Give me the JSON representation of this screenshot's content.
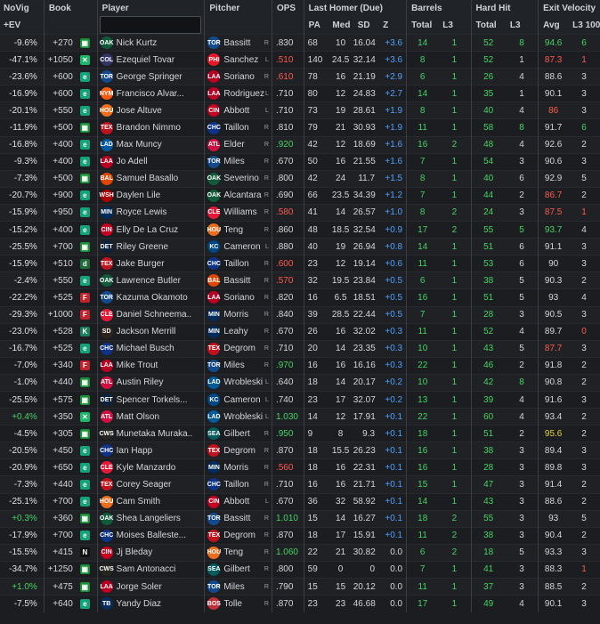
{
  "headers": {
    "novig": "NoVig",
    "novig2": "+EV",
    "book": "Book",
    "player": "Player",
    "pitcher": "Pitcher",
    "ops": "OPS",
    "last_homer": "Last Homer (Due)",
    "barrels": "Barrels",
    "hard_hit": "Hard Hit",
    "exit_velocity": "Exit Velocity",
    "pa": "PA",
    "med": "Med",
    "sd": "SD",
    "z": "Z",
    "bar_total": "Total",
    "bar_l3": "L3",
    "hh_total": "Total",
    "hh_l3": "L3",
    "ev_avg": "Avg",
    "ev_l3": "L3 100"
  },
  "search": {
    "placeholder": ""
  },
  "colors": {
    "pos": "#45d363",
    "neg": "#ff5a4f",
    "z": "#4ea1ff",
    "mid": "#e3d23f"
  },
  "rows": [
    {
      "nv": "-9.6%",
      "odds": "+270",
      "book": "B",
      "player": "Nick Kurtz",
      "tm": "OAK",
      "pitcher": "Bassitt",
      "ptm": "TOR",
      "hand": "R",
      "ops": ".830",
      "opsc": "wh",
      "pa": "68",
      "med": "10",
      "sd": "16.04",
      "z": "+3.6",
      "bt": "14",
      "bl3": "1",
      "ht": "52",
      "hl3": "8",
      "hl3c": "gn",
      "avg": "94.6",
      "avgc": "gn",
      "l3": "6",
      "l3c": "gn"
    },
    {
      "nv": "-47.1%",
      "odds": "+1050",
      "book": "X",
      "player": "Ezequiel Tovar",
      "tm": "COL",
      "pitcher": "Sanchez",
      "ptm": "PHI",
      "hand": "L",
      "ops": ".510",
      "opsc": "ops-r",
      "pa": "140",
      "med": "24.5",
      "sd": "32.14",
      "z": "+3.6",
      "bt": "8",
      "bl3": "1",
      "ht": "52",
      "hl3": "1",
      "hl3c": "wh",
      "avg": "87.3",
      "avgc": "rd",
      "l3": "1",
      "l3c": "rd"
    },
    {
      "nv": "-23.6%",
      "odds": "+600",
      "book": "E",
      "player": "George Springer",
      "tm": "TOR",
      "pitcher": "Soriano",
      "ptm": "LAA",
      "hand": "R",
      "ops": ".610",
      "opsc": "ops-r",
      "pa": "78",
      "med": "16",
      "sd": "21.19",
      "z": "+2.9",
      "bt": "6",
      "bl3": "1",
      "ht": "26",
      "hl3": "4",
      "hl3c": "wh",
      "avg": "88.6",
      "avgc": "wh",
      "l3": "3",
      "l3c": "wh"
    },
    {
      "nv": "-16.9%",
      "odds": "+600",
      "book": "E",
      "player": "Francisco Alvar...",
      "tm": "NYM",
      "pitcher": "Rodriguez",
      "ptm": "LAA",
      "hand": "L",
      "ops": ".710",
      "opsc": "wh",
      "pa": "80",
      "med": "12",
      "sd": "24.83",
      "z": "+2.7",
      "bt": "14",
      "bl3": "1",
      "ht": "35",
      "hl3": "1",
      "hl3c": "wh",
      "avg": "90.1",
      "avgc": "wh",
      "l3": "3",
      "l3c": "wh"
    },
    {
      "nv": "-20.1%",
      "odds": "+550",
      "book": "E",
      "player": "Jose Altuve",
      "tm": "HOU",
      "pitcher": "Abbott",
      "ptm": "CIN",
      "hand": "L",
      "ops": ".710",
      "opsc": "wh",
      "pa": "73",
      "med": "19",
      "sd": "28.61",
      "z": "+1.9",
      "bt": "8",
      "bl3": "1",
      "ht": "40",
      "hl3": "4",
      "hl3c": "wh",
      "avg": "86",
      "avgc": "rd",
      "l3": "3",
      "l3c": "wh"
    },
    {
      "nv": "-11.9%",
      "odds": "+500",
      "book": "B",
      "player": "Brandon Nimmo",
      "tm": "TEX",
      "pitcher": "Taillon",
      "ptm": "CHC",
      "hand": "R",
      "ops": ".810",
      "opsc": "wh",
      "pa": "79",
      "med": "21",
      "sd": "30.93",
      "z": "+1.9",
      "bt": "11",
      "bl3": "1",
      "ht": "58",
      "hl3": "8",
      "hl3c": "gn",
      "avg": "91.7",
      "avgc": "wh",
      "l3": "6",
      "l3c": "gn"
    },
    {
      "nv": "-16.8%",
      "odds": "+400",
      "book": "E",
      "player": "Max Muncy",
      "tm": "LAD",
      "pitcher": "Elder",
      "ptm": "ATL",
      "hand": "R",
      "ops": ".920",
      "opsc": "ops-g",
      "pa": "42",
      "med": "12",
      "sd": "18.69",
      "z": "+1.6",
      "bt": "16",
      "bl3": "2",
      "ht": "48",
      "hl3": "4",
      "hl3c": "wh",
      "avg": "92.6",
      "avgc": "wh",
      "l3": "2",
      "l3c": "wh"
    },
    {
      "nv": "-9.3%",
      "odds": "+400",
      "book": "E",
      "player": "Jo Adell",
      "tm": "LAA",
      "pitcher": "Miles",
      "ptm": "TOR",
      "hand": "R",
      "ops": ".670",
      "opsc": "wh",
      "pa": "50",
      "med": "16",
      "sd": "21.55",
      "z": "+1.6",
      "bt": "7",
      "bl3": "1",
      "ht": "54",
      "hl3": "3",
      "hl3c": "wh",
      "avg": "90.6",
      "avgc": "wh",
      "l3": "3",
      "l3c": "wh"
    },
    {
      "nv": "-7.3%",
      "odds": "+500",
      "book": "B",
      "player": "Samuel Basallo",
      "tm": "BAL",
      "pitcher": "Severino",
      "ptm": "OAK",
      "hand": "R",
      "ops": ".800",
      "opsc": "wh",
      "pa": "42",
      "med": "24",
      "sd": "11.7",
      "z": "+1.5",
      "bt": "8",
      "bl3": "1",
      "ht": "40",
      "hl3": "6",
      "hl3c": "wh",
      "avg": "92.9",
      "avgc": "wh",
      "l3": "5",
      "l3c": "wh"
    },
    {
      "nv": "-20.7%",
      "odds": "+900",
      "book": "E",
      "player": "Daylen Lile",
      "tm": "WSH",
      "pitcher": "Alcantara",
      "ptm": "OAK",
      "hand": "R",
      "ops": ".690",
      "opsc": "wh",
      "pa": "66",
      "med": "23.5",
      "sd": "34.39",
      "z": "+1.2",
      "bt": "7",
      "bl3": "1",
      "ht": "44",
      "hl3": "2",
      "hl3c": "wh",
      "avg": "86.7",
      "avgc": "rd",
      "l3": "2",
      "l3c": "wh"
    },
    {
      "nv": "-15.9%",
      "odds": "+950",
      "book": "E",
      "player": "Royce Lewis",
      "tm": "MIN",
      "pitcher": "Williams",
      "ptm": "CLE",
      "hand": "R",
      "ops": ".580",
      "opsc": "ops-r",
      "pa": "41",
      "med": "14",
      "sd": "26.57",
      "z": "+1.0",
      "bt": "8",
      "bl3": "2",
      "ht": "24",
      "hl3": "3",
      "hl3c": "wh",
      "avg": "87.5",
      "avgc": "rd",
      "l3": "1",
      "l3c": "rd"
    },
    {
      "nv": "-15.2%",
      "odds": "+400",
      "book": "E",
      "player": "Elly De La Cruz",
      "tm": "CIN",
      "pitcher": "Teng",
      "ptm": "HOU",
      "hand": "R",
      "ops": ".860",
      "opsc": "wh",
      "pa": "48",
      "med": "18.5",
      "sd": "32.54",
      "z": "+0.9",
      "bt": "17",
      "bl3": "2",
      "ht": "55",
      "hl3": "5",
      "hl3c": "gn",
      "avg": "93.7",
      "avgc": "gn",
      "l3": "4",
      "l3c": "wh"
    },
    {
      "nv": "-25.5%",
      "odds": "+700",
      "book": "B",
      "player": "Riley Greene",
      "tm": "DET",
      "pitcher": "Cameron",
      "ptm": "KC",
      "hand": "L",
      "ops": ".880",
      "opsc": "wh",
      "pa": "40",
      "med": "19",
      "sd": "26.94",
      "z": "+0.8",
      "bt": "14",
      "bl3": "1",
      "ht": "51",
      "hl3": "6",
      "hl3c": "wh",
      "avg": "91.1",
      "avgc": "wh",
      "l3": "3",
      "l3c": "wh"
    },
    {
      "nv": "-15.9%",
      "odds": "+510",
      "book": "D",
      "player": "Jake Burger",
      "tm": "TEX",
      "pitcher": "Taillon",
      "ptm": "CHC",
      "hand": "R",
      "ops": ".600",
      "opsc": "ops-r",
      "pa": "23",
      "med": "12",
      "sd": "19.14",
      "z": "+0.6",
      "bt": "11",
      "bl3": "1",
      "ht": "53",
      "hl3": "6",
      "hl3c": "wh",
      "avg": "90",
      "avgc": "wh",
      "l3": "3",
      "l3c": "wh"
    },
    {
      "nv": "-2.4%",
      "odds": "+550",
      "book": "E",
      "player": "Lawrence Butler",
      "tm": "OAK",
      "pitcher": "Bassitt",
      "ptm": "BAL",
      "hand": "R",
      "ops": ".570",
      "opsc": "ops-r",
      "pa": "32",
      "med": "19.5",
      "sd": "23.84",
      "z": "+0.5",
      "bt": "6",
      "bl3": "1",
      "ht": "38",
      "hl3": "5",
      "hl3c": "wh",
      "avg": "90.3",
      "avgc": "wh",
      "l3": "2",
      "l3c": "wh"
    },
    {
      "nv": "-22.2%",
      "odds": "+525",
      "book": "F",
      "player": "Kazuma Okamoto",
      "tm": "TOR",
      "pitcher": "Soriano",
      "ptm": "LAA",
      "hand": "R",
      "ops": ".820",
      "opsc": "wh",
      "pa": "16",
      "med": "6.5",
      "sd": "18.51",
      "z": "+0.5",
      "bt": "16",
      "bl3": "1",
      "ht": "51",
      "hl3": "5",
      "hl3c": "wh",
      "avg": "93",
      "avgc": "wh",
      "l3": "4",
      "l3c": "wh"
    },
    {
      "nv": "-29.3%",
      "odds": "+1000",
      "book": "F",
      "player": "Daniel Schneema...",
      "tm": "CLE",
      "pitcher": "Morris",
      "ptm": "MIN",
      "hand": "R",
      "ops": ".840",
      "opsc": "wh",
      "pa": "39",
      "med": "28.5",
      "sd": "22.44",
      "z": "+0.5",
      "bt": "7",
      "bl3": "1",
      "ht": "28",
      "hl3": "3",
      "hl3c": "wh",
      "avg": "90.5",
      "avgc": "wh",
      "l3": "3",
      "l3c": "wh"
    },
    {
      "nv": "-23.0%",
      "odds": "+528",
      "book": "K",
      "player": "Jackson Merrill",
      "tm": "SD",
      "pitcher": "Leahy",
      "ptm": "MIN",
      "hand": "R",
      "ops": ".670",
      "opsc": "wh",
      "pa": "26",
      "med": "16",
      "sd": "32.02",
      "z": "+0.3",
      "bt": "11",
      "bl3": "1",
      "ht": "52",
      "hl3": "4",
      "hl3c": "wh",
      "avg": "89.7",
      "avgc": "wh",
      "l3": "0",
      "l3c": "rd"
    },
    {
      "nv": "-16.7%",
      "odds": "+525",
      "book": "E",
      "player": "Michael Busch",
      "tm": "CHC",
      "pitcher": "Degrom",
      "ptm": "TEX",
      "hand": "R",
      "ops": ".710",
      "opsc": "wh",
      "pa": "20",
      "med": "14",
      "sd": "23.35",
      "z": "+0.3",
      "bt": "10",
      "bl3": "1",
      "ht": "43",
      "hl3": "5",
      "hl3c": "wh",
      "avg": "87.7",
      "avgc": "rd",
      "l3": "3",
      "l3c": "wh"
    },
    {
      "nv": "-7.0%",
      "odds": "+340",
      "book": "F",
      "player": "Mike Trout",
      "tm": "LAA",
      "pitcher": "Miles",
      "ptm": "TOR",
      "hand": "R",
      "ops": ".970",
      "opsc": "ops-g",
      "pa": "16",
      "med": "16",
      "sd": "16.16",
      "z": "+0.3",
      "bt": "22",
      "bl3": "1",
      "ht": "46",
      "hl3": "2",
      "hl3c": "wh",
      "avg": "91.8",
      "avgc": "wh",
      "l3": "2",
      "l3c": "wh"
    },
    {
      "nv": "-1.0%",
      "odds": "+440",
      "book": "B",
      "player": "Austin Riley",
      "tm": "ATL",
      "pitcher": "Wrobleski",
      "ptm": "LAD",
      "hand": "L",
      "ops": ".640",
      "opsc": "wh",
      "pa": "18",
      "med": "14",
      "sd": "20.17",
      "z": "+0.2",
      "bt": "10",
      "bl3": "1",
      "ht": "42",
      "hl3": "8",
      "hl3c": "gn",
      "avg": "90.8",
      "avgc": "wh",
      "l3": "2",
      "l3c": "wh"
    },
    {
      "nv": "-25.5%",
      "odds": "+575",
      "book": "B",
      "player": "Spencer Torkels...",
      "tm": "DET",
      "pitcher": "Cameron",
      "ptm": "KC",
      "hand": "L",
      "ops": ".740",
      "opsc": "wh",
      "pa": "23",
      "med": "17",
      "sd": "32.07",
      "z": "+0.2",
      "bt": "13",
      "bl3": "1",
      "ht": "39",
      "hl3": "4",
      "hl3c": "wh",
      "avg": "91.6",
      "avgc": "wh",
      "l3": "3",
      "l3c": "wh"
    },
    {
      "nv": "+0.4%",
      "odds": "+350",
      "book": "X",
      "player": "Matt Olson",
      "tm": "ATL",
      "pitcher": "Wrobleski",
      "ptm": "LAD",
      "hand": "L",
      "ops": "1.030",
      "opsc": "ops-g",
      "pa": "14",
      "med": "12",
      "sd": "17.91",
      "z": "+0.1",
      "bt": "22",
      "bl3": "1",
      "ht": "60",
      "hl3": "4",
      "hl3c": "wh",
      "avg": "93.4",
      "avgc": "wh",
      "l3": "2",
      "l3c": "wh"
    },
    {
      "nv": "-4.5%",
      "odds": "+305",
      "book": "B",
      "player": "Munetaka Muraka...",
      "tm": "CWS",
      "pitcher": "Gilbert",
      "ptm": "SEA",
      "hand": "R",
      "ops": ".950",
      "opsc": "ops-g",
      "pa": "9",
      "med": "8",
      "sd": "9.3",
      "z": "+0.1",
      "bt": "18",
      "bl3": "1",
      "ht": "51",
      "hl3": "2",
      "hl3c": "wh",
      "avg": "95.6",
      "avgc": "yw",
      "l3": "2",
      "l3c": "wh"
    },
    {
      "nv": "-20.5%",
      "odds": "+450",
      "book": "E",
      "player": "Ian Happ",
      "tm": "CHC",
      "pitcher": "Degrom",
      "ptm": "TEX",
      "hand": "R",
      "ops": ".870",
      "opsc": "wh",
      "pa": "18",
      "med": "15.5",
      "sd": "26.23",
      "z": "+0.1",
      "bt": "16",
      "bl3": "1",
      "ht": "38",
      "hl3": "3",
      "hl3c": "wh",
      "avg": "89.4",
      "avgc": "wh",
      "l3": "3",
      "l3c": "wh"
    },
    {
      "nv": "-20.9%",
      "odds": "+650",
      "book": "E",
      "player": "Kyle Manzardo",
      "tm": "CLE",
      "pitcher": "Morris",
      "ptm": "MIN",
      "hand": "R",
      "ops": ".560",
      "opsc": "ops-r",
      "pa": "18",
      "med": "16",
      "sd": "22.31",
      "z": "+0.1",
      "bt": "16",
      "bl3": "1",
      "ht": "28",
      "hl3": "3",
      "hl3c": "wh",
      "avg": "89.8",
      "avgc": "wh",
      "l3": "3",
      "l3c": "wh"
    },
    {
      "nv": "-7.3%",
      "odds": "+440",
      "book": "E",
      "player": "Corey Seager",
      "tm": "TEX",
      "pitcher": "Taillon",
      "ptm": "CHC",
      "hand": "R",
      "ops": ".710",
      "opsc": "wh",
      "pa": "16",
      "med": "16",
      "sd": "21.71",
      "z": "+0.1",
      "bt": "15",
      "bl3": "1",
      "ht": "47",
      "hl3": "3",
      "hl3c": "wh",
      "avg": "91.4",
      "avgc": "wh",
      "l3": "2",
      "l3c": "wh"
    },
    {
      "nv": "-25.1%",
      "odds": "+700",
      "book": "E",
      "player": "Cam Smith",
      "tm": "HOU",
      "pitcher": "Abbott",
      "ptm": "CIN",
      "hand": "L",
      "ops": ".670",
      "opsc": "wh",
      "pa": "36",
      "med": "32",
      "sd": "58.92",
      "z": "+0.1",
      "bt": "14",
      "bl3": "1",
      "ht": "43",
      "hl3": "3",
      "hl3c": "wh",
      "avg": "88.6",
      "avgc": "wh",
      "l3": "2",
      "l3c": "wh"
    },
    {
      "nv": "+0.3%",
      "odds": "+360",
      "book": "B",
      "player": "Shea Langeliers",
      "tm": "OAK",
      "pitcher": "Bassitt",
      "ptm": "TOR",
      "hand": "R",
      "ops": "1.010",
      "opsc": "ops-g",
      "pa": "15",
      "med": "14",
      "sd": "16.27",
      "z": "+0.1",
      "bt": "18",
      "bl3": "2",
      "ht": "55",
      "hl3": "3",
      "hl3c": "wh",
      "avg": "93",
      "avgc": "wh",
      "l3": "5",
      "l3c": "wh"
    },
    {
      "nv": "-17.9%",
      "odds": "+700",
      "book": "E",
      "player": "Moises Balleste...",
      "tm": "CHC",
      "pitcher": "Degrom",
      "ptm": "TEX",
      "hand": "R",
      "ops": ".870",
      "opsc": "wh",
      "pa": "18",
      "med": "17",
      "sd": "15.91",
      "z": "+0.1",
      "bt": "11",
      "bl3": "2",
      "ht": "38",
      "hl3": "3",
      "hl3c": "wh",
      "avg": "90.4",
      "avgc": "wh",
      "l3": "2",
      "l3c": "wh"
    },
    {
      "nv": "-15.5%",
      "odds": "+415",
      "book": "N",
      "player": "Jj Bleday",
      "tm": "CIN",
      "pitcher": "Teng",
      "ptm": "HOU",
      "hand": "R",
      "ops": "1.060",
      "opsc": "ops-g",
      "pa": "22",
      "med": "21",
      "sd": "30.82",
      "z": "0.0",
      "bt": "6",
      "bl3": "2",
      "ht": "18",
      "hl3": "5",
      "hl3c": "wh",
      "avg": "93.3",
      "avgc": "wh",
      "l3": "3",
      "l3c": "wh"
    },
    {
      "nv": "-34.7%",
      "odds": "+1250",
      "book": "B",
      "player": "Sam Antonacci",
      "tm": "CWS",
      "pitcher": "Gilbert",
      "ptm": "SEA",
      "hand": "R",
      "ops": ".800",
      "opsc": "wh",
      "pa": "59",
      "med": "0",
      "sd": "0",
      "z": "0.0",
      "bt": "7",
      "bl3": "1",
      "ht": "41",
      "hl3": "3",
      "hl3c": "wh",
      "avg": "88.3",
      "avgc": "wh",
      "l3": "1",
      "l3c": "rd"
    },
    {
      "nv": "+1.0%",
      "odds": "+475",
      "book": "B",
      "player": "Jorge Soler",
      "tm": "LAA",
      "pitcher": "Miles",
      "ptm": "TOR",
      "hand": "R",
      "ops": ".790",
      "opsc": "wh",
      "pa": "15",
      "med": "15",
      "sd": "20.12",
      "z": "0.0",
      "bt": "11",
      "bl3": "1",
      "ht": "37",
      "hl3": "3",
      "hl3c": "wh",
      "avg": "88.5",
      "avgc": "wh",
      "l3": "2",
      "l3c": "wh"
    },
    {
      "nv": "-7.5%",
      "odds": "+640",
      "book": "E",
      "player": "Yandy Diaz",
      "tm": "TB",
      "pitcher": "Tolle",
      "ptm": "BOS",
      "hand": "R",
      "ops": ".870",
      "opsc": "wh",
      "pa": "23",
      "med": "23",
      "sd": "46.68",
      "z": "0.0",
      "bt": "17",
      "bl3": "1",
      "ht": "49",
      "hl3": "4",
      "hl3c": "wh",
      "avg": "90.1",
      "avgc": "wh",
      "l3": "3",
      "l3c": "wh"
    }
  ]
}
